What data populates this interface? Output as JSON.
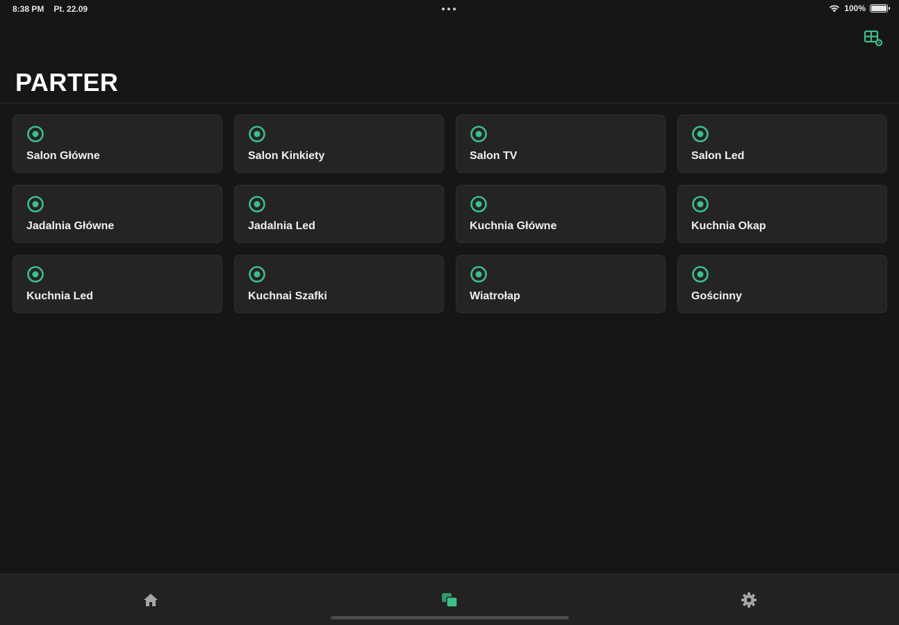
{
  "status_bar": {
    "time": "8:38 PM",
    "date": "Pt. 22.09",
    "battery": "100%"
  },
  "header": {
    "title": "PARTER"
  },
  "colors": {
    "accent": "#3dbf8a",
    "background": "#161616",
    "tile": "#242424",
    "nav_inactive": "#a6a6a6"
  },
  "tiles": [
    {
      "label": "Salon Główne",
      "icon": "radio-target-icon"
    },
    {
      "label": "Salon Kinkiety",
      "icon": "radio-target-icon"
    },
    {
      "label": "Salon TV",
      "icon": "radio-target-icon"
    },
    {
      "label": "Salon Led",
      "icon": "radio-target-icon"
    },
    {
      "label": "Jadalnia Główne",
      "icon": "radio-target-icon"
    },
    {
      "label": "Jadalnia Led",
      "icon": "radio-target-icon"
    },
    {
      "label": "Kuchnia Główne",
      "icon": "radio-target-icon"
    },
    {
      "label": "Kuchnia Okap",
      "icon": "radio-target-icon"
    },
    {
      "label": "Kuchnia Led",
      "icon": "radio-target-icon"
    },
    {
      "label": "Kuchnai Szafki",
      "icon": "radio-target-icon"
    },
    {
      "label": "Wiatrołap",
      "icon": "radio-target-icon"
    },
    {
      "label": "Gościnny",
      "icon": "radio-target-icon"
    }
  ],
  "bottom_nav": {
    "items": [
      {
        "icon": "home-icon",
        "active": false
      },
      {
        "icon": "layers-icon",
        "active": true
      },
      {
        "icon": "gear-icon",
        "active": false
      }
    ]
  }
}
